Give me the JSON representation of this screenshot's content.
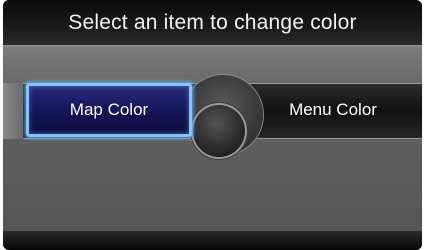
{
  "header": {
    "title": "Select an item to change color"
  },
  "menu": {
    "items": [
      {
        "label": "Map Color",
        "selected": true
      },
      {
        "label": "Menu Color",
        "selected": false
      }
    ]
  },
  "colors": {
    "selection_border": "#7fc6ff",
    "selection_fill": "#1a1a66",
    "header_background": "#111111",
    "body_background": "#5d5d5d"
  }
}
